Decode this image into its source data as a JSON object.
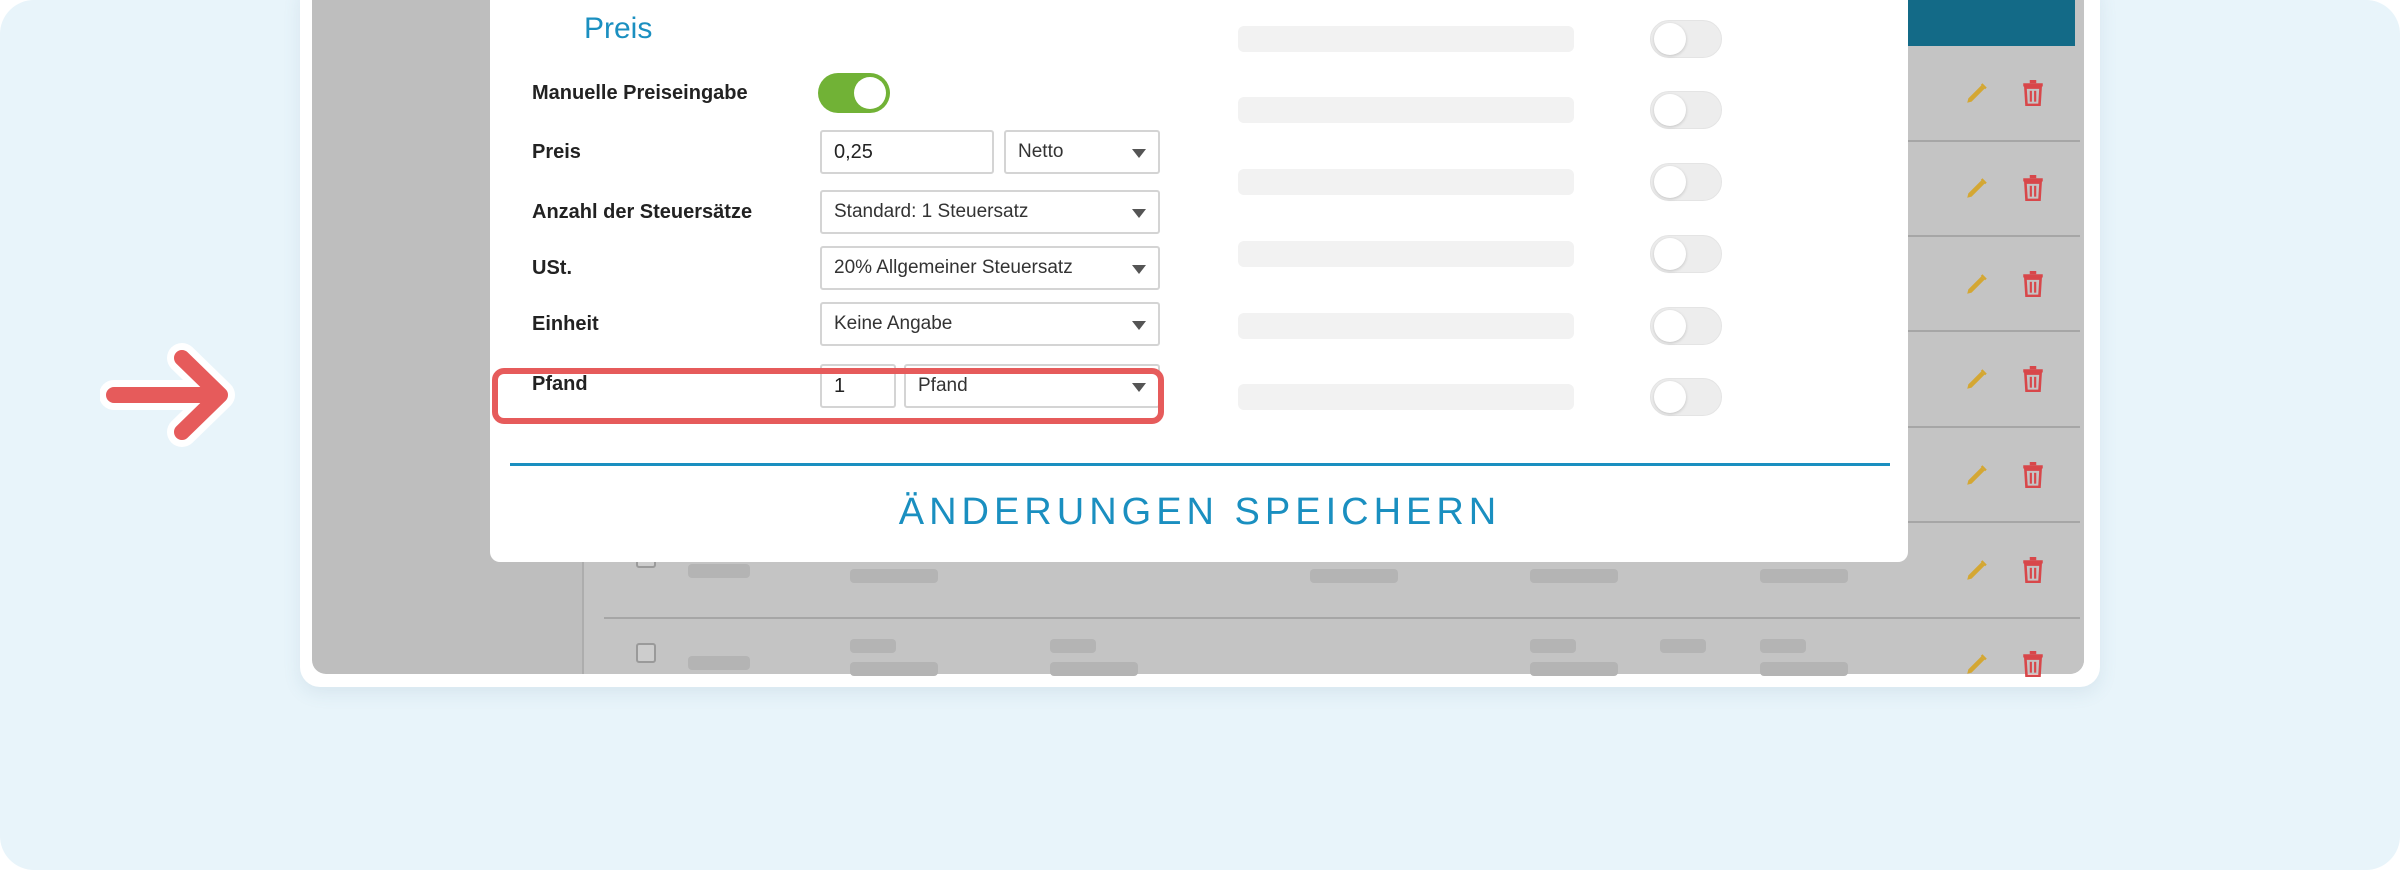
{
  "modal": {
    "section_title": "Preis",
    "fields": {
      "manual_price": {
        "label": "Manuelle Preiseingabe",
        "toggle_on": true
      },
      "price": {
        "label": "Preis",
        "value": "0,25",
        "type_selected": "Netto"
      },
      "tax_count": {
        "label": "Anzahl der Steuersätze",
        "selected": "Standard: 1 Steuersatz"
      },
      "vat": {
        "label": "USt.",
        "selected": "20% Allgemeiner Steuersatz"
      },
      "unit": {
        "label": "Einheit",
        "selected": "Keine Angabe"
      },
      "deposit": {
        "label": "Pfand",
        "quantity": "1",
        "selected": "Pfand"
      }
    },
    "save_label": "ÄNDERUNGEN SPEICHERN"
  },
  "colors": {
    "accent": "#1a8fc0",
    "toggle_on": "#71b236",
    "highlight": "#e65b5b",
    "edit_icon": "#d4a733",
    "delete_icon": "#d8474a",
    "header_bar": "#136a87"
  },
  "icons": [
    "arrow-right-icon",
    "pencil-icon",
    "trash-icon",
    "chevron-down-icon"
  ]
}
